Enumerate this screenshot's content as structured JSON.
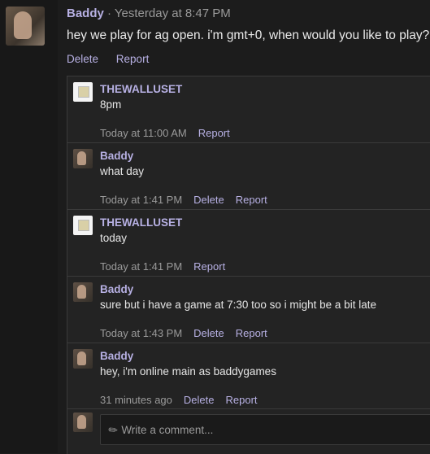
{
  "post": {
    "author": "Baddy",
    "meta": " · Yesterday at 8:47 PM",
    "text": "hey we play for ag open. i'm gmt+0, when would you like to play?",
    "actions": {
      "delete": "Delete",
      "report": "Report"
    }
  },
  "replies": [
    {
      "author": "THEWALLUSET",
      "avatar": "tower-avatar",
      "text": "8pm",
      "time": "Today at 11:00 AM",
      "delete": "",
      "report": "Report"
    },
    {
      "author": "Baddy",
      "avatar": "hand-avatar",
      "text": "what day",
      "time": "Today at 1:41 PM",
      "delete": "Delete",
      "report": "Report"
    },
    {
      "author": "THEWALLUSET",
      "avatar": "tower-avatar",
      "text": "today",
      "time": "Today at 1:41 PM",
      "delete": "",
      "report": "Report"
    },
    {
      "author": "Baddy",
      "avatar": "hand-avatar",
      "text": "sure but i have a game at 7:30 too so i might be a bit late",
      "time": "Today at 1:43 PM",
      "delete": "Delete",
      "report": "Report"
    },
    {
      "author": "Baddy",
      "avatar": "hand-avatar",
      "text": "hey, i'm online main as baddygames",
      "time": "31 minutes ago",
      "delete": "Delete",
      "report": "Report"
    }
  ],
  "composer": {
    "placeholder": "Write a comment...",
    "icon": "pencil-icon"
  },
  "colors": {
    "accent": "#b7b0e3",
    "background": "#1c1c1c",
    "panel": "#232323",
    "muted": "#9a9a9a"
  }
}
